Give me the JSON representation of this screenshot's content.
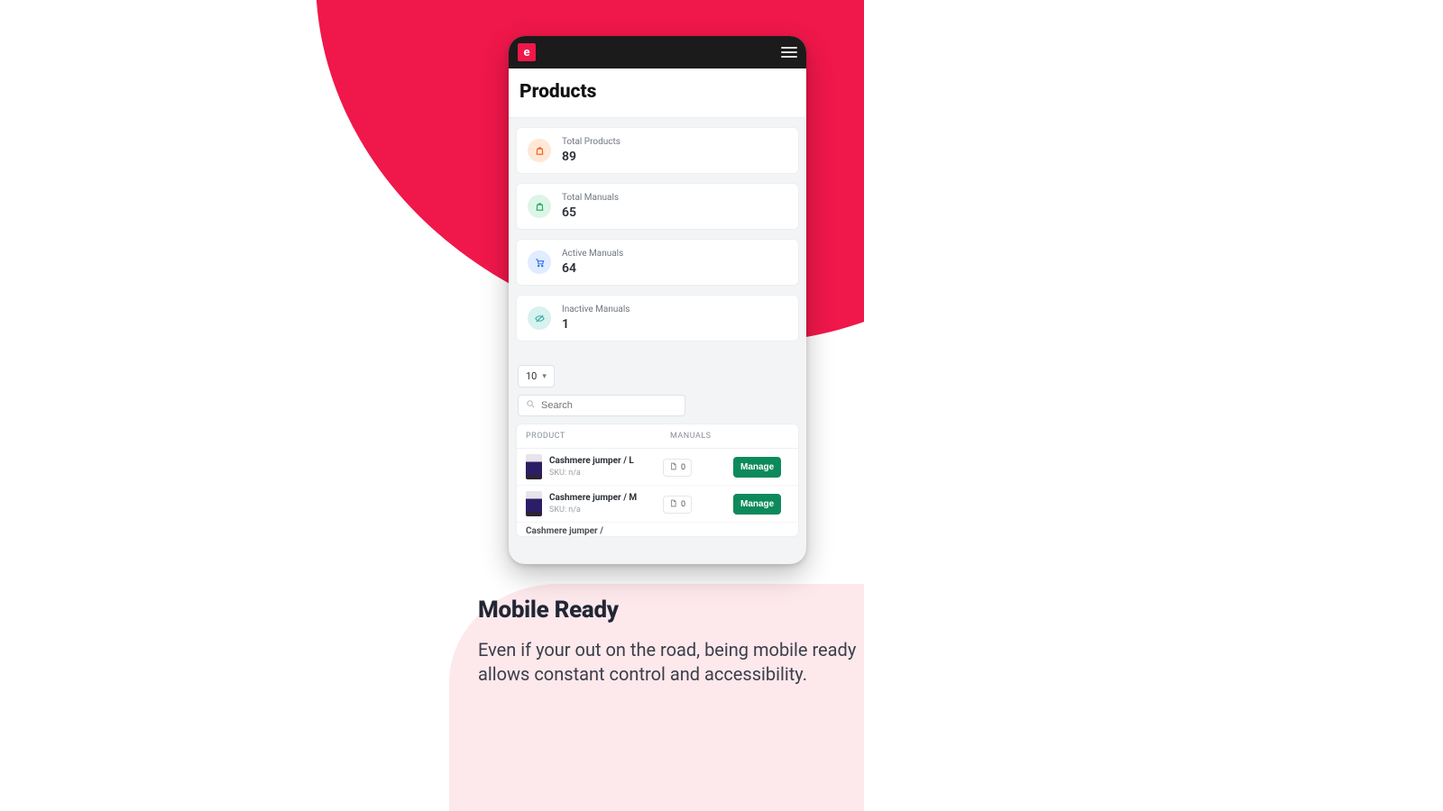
{
  "logo_letter": "e",
  "page_title": "Products",
  "stats": [
    {
      "label": "Total Products",
      "value": "89"
    },
    {
      "label": "Total Manuals",
      "value": "65"
    },
    {
      "label": "Active Manuals",
      "value": "64"
    },
    {
      "label": "Inactive Manuals",
      "value": "1"
    }
  ],
  "page_size": "10",
  "search_placeholder": "Search",
  "columns": {
    "product": "PRODUCT",
    "manuals": "MANUALS"
  },
  "rows": [
    {
      "name": "Cashmere jumper / L",
      "sku": "SKU: n/a",
      "manual_count": "0",
      "action": "Manage"
    },
    {
      "name": "Cashmere jumper / M",
      "sku": "SKU: n/a",
      "manual_count": "0",
      "action": "Manage"
    }
  ],
  "partial_row_name": "Cashmere jumper /",
  "marketing": {
    "heading": "Mobile Ready",
    "body": "Even if your out on the road, being mobile ready allows constant control and accessibility."
  }
}
